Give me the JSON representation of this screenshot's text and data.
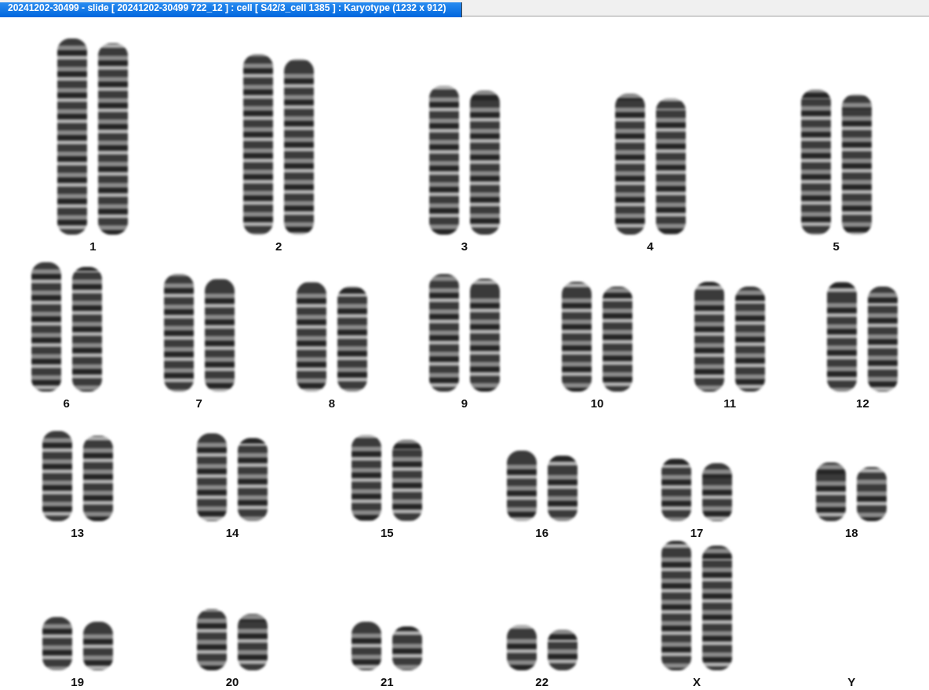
{
  "window": {
    "title": "20241202-30499 - slide [ 20241202-30499 722_12 ] : cell [ S42/3_cell 1385 ] : Karyotype  (1232 x 912)"
  },
  "karyogram": {
    "rows": [
      {
        "pairs": [
          {
            "label": "1",
            "kind": "pair"
          },
          {
            "label": "2",
            "kind": "pair"
          },
          {
            "label": "3",
            "kind": "pair"
          },
          {
            "label": "4",
            "kind": "pair"
          },
          {
            "label": "5",
            "kind": "pair"
          }
        ]
      },
      {
        "pairs": [
          {
            "label": "6",
            "kind": "pair"
          },
          {
            "label": "7",
            "kind": "pair"
          },
          {
            "label": "8",
            "kind": "pair"
          },
          {
            "label": "9",
            "kind": "pair"
          },
          {
            "label": "10",
            "kind": "pair"
          },
          {
            "label": "11",
            "kind": "pair"
          },
          {
            "label": "12",
            "kind": "pair"
          }
        ]
      },
      {
        "pairs": [
          {
            "label": "13",
            "kind": "pair"
          },
          {
            "label": "14",
            "kind": "pair"
          },
          {
            "label": "15",
            "kind": "pair"
          },
          {
            "label": "16",
            "kind": "pair"
          },
          {
            "label": "17",
            "kind": "pair"
          },
          {
            "label": "18",
            "kind": "pair"
          }
        ]
      },
      {
        "pairs": [
          {
            "label": "19",
            "kind": "pair"
          },
          {
            "label": "20",
            "kind": "pair"
          },
          {
            "label": "21",
            "kind": "pair"
          },
          {
            "label": "22",
            "kind": "pair"
          },
          {
            "label": "X",
            "kind": "pair"
          },
          {
            "label": "Y",
            "kind": "empty"
          }
        ]
      }
    ]
  }
}
